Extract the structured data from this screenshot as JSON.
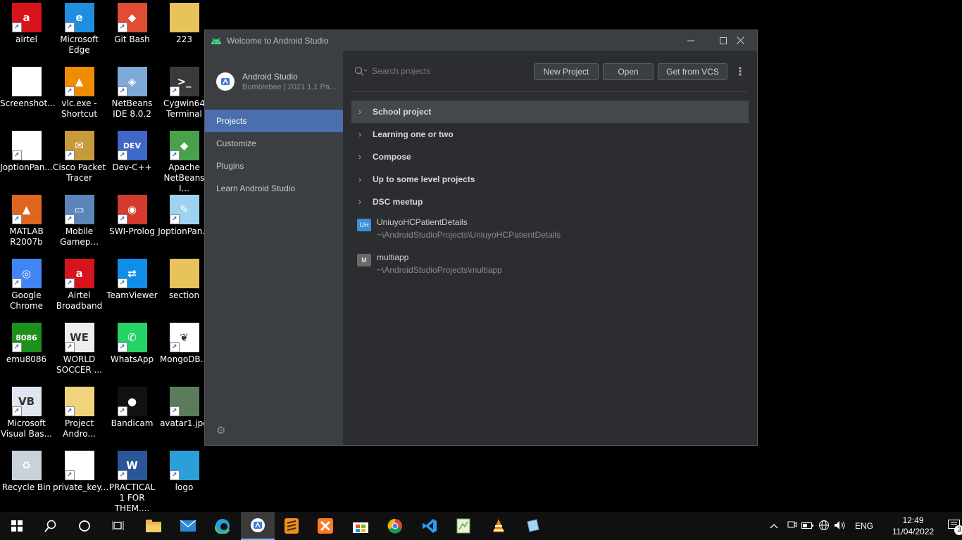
{
  "desktop": {
    "icons": [
      {
        "label": "airtel"
      },
      {
        "label": "Microsoft Edge"
      },
      {
        "label": "Git Bash"
      },
      {
        "label": "223"
      },
      {
        "label": "Screenshot..."
      },
      {
        "label": "vlc.exe - Shortcut"
      },
      {
        "label": "NetBeans IDE 8.0.2"
      },
      {
        "label": "Cygwin64 Terminal"
      },
      {
        "label": "JoptionPan..."
      },
      {
        "label": "Cisco Packet Tracer"
      },
      {
        "label": "Dev-C++"
      },
      {
        "label": "Apache NetBeans I..."
      },
      {
        "label": "MATLAB R2007b"
      },
      {
        "label": "Mobile Gamep..."
      },
      {
        "label": "SWI-Prolog"
      },
      {
        "label": "JoptionPan..."
      },
      {
        "label": "Google Chrome"
      },
      {
        "label": "Airtel Broadband"
      },
      {
        "label": "TeamViewer"
      },
      {
        "label": "section"
      },
      {
        "label": "emu8086"
      },
      {
        "label": "WORLD SOCCER ..."
      },
      {
        "label": "WhatsApp"
      },
      {
        "label": "MongoDB..."
      },
      {
        "label": "Microsoft Visual Bas..."
      },
      {
        "label": "Project Andro..."
      },
      {
        "label": "Bandicam"
      },
      {
        "label": "avatar1.jpg"
      },
      {
        "label": "Recycle Bin"
      },
      {
        "label": "private_key..."
      },
      {
        "label": "PRACTICAL 1 FOR THEM...."
      },
      {
        "label": "logo"
      }
    ]
  },
  "window": {
    "title": "Welcome to Android Studio",
    "brand": {
      "name": "Android Studio",
      "version": "Bumblebee | 2021.1.1 Pa..."
    },
    "nav": [
      {
        "label": "Projects",
        "active": true
      },
      {
        "label": "Customize"
      },
      {
        "label": "Plugins"
      },
      {
        "label": "Learn Android Studio"
      }
    ],
    "search": {
      "placeholder": "Search projects"
    },
    "buttons": {
      "new_project": "New Project",
      "open": "Open",
      "get_from_vcs": "Get from VCS"
    },
    "groups": [
      {
        "label": "School project",
        "selected": true
      },
      {
        "label": "Learning one or two"
      },
      {
        "label": "Compose"
      },
      {
        "label": "Up to some level projects"
      },
      {
        "label": "DSC meetup"
      }
    ],
    "projects": [
      {
        "badge": "UH",
        "name": "UniuyoHCPatientDetails",
        "path": "~\\AndroidStudioProjects\\UniuyoHCPatientDetails",
        "badge_color": "#3d8fd6"
      },
      {
        "badge": "M",
        "name": "multiapp",
        "path": "~\\AndroidStudioProjects\\multiapp",
        "badge_color": "#6a6a6a"
      }
    ]
  },
  "taskbar": {
    "language": "ENG",
    "time": "12:49",
    "date": "11/04/2022",
    "notification_count": "3"
  },
  "colors": {
    "accent": "#4b6eaf",
    "window_bg": "#2b2d30",
    "sidebar_bg": "#3c3f41"
  }
}
